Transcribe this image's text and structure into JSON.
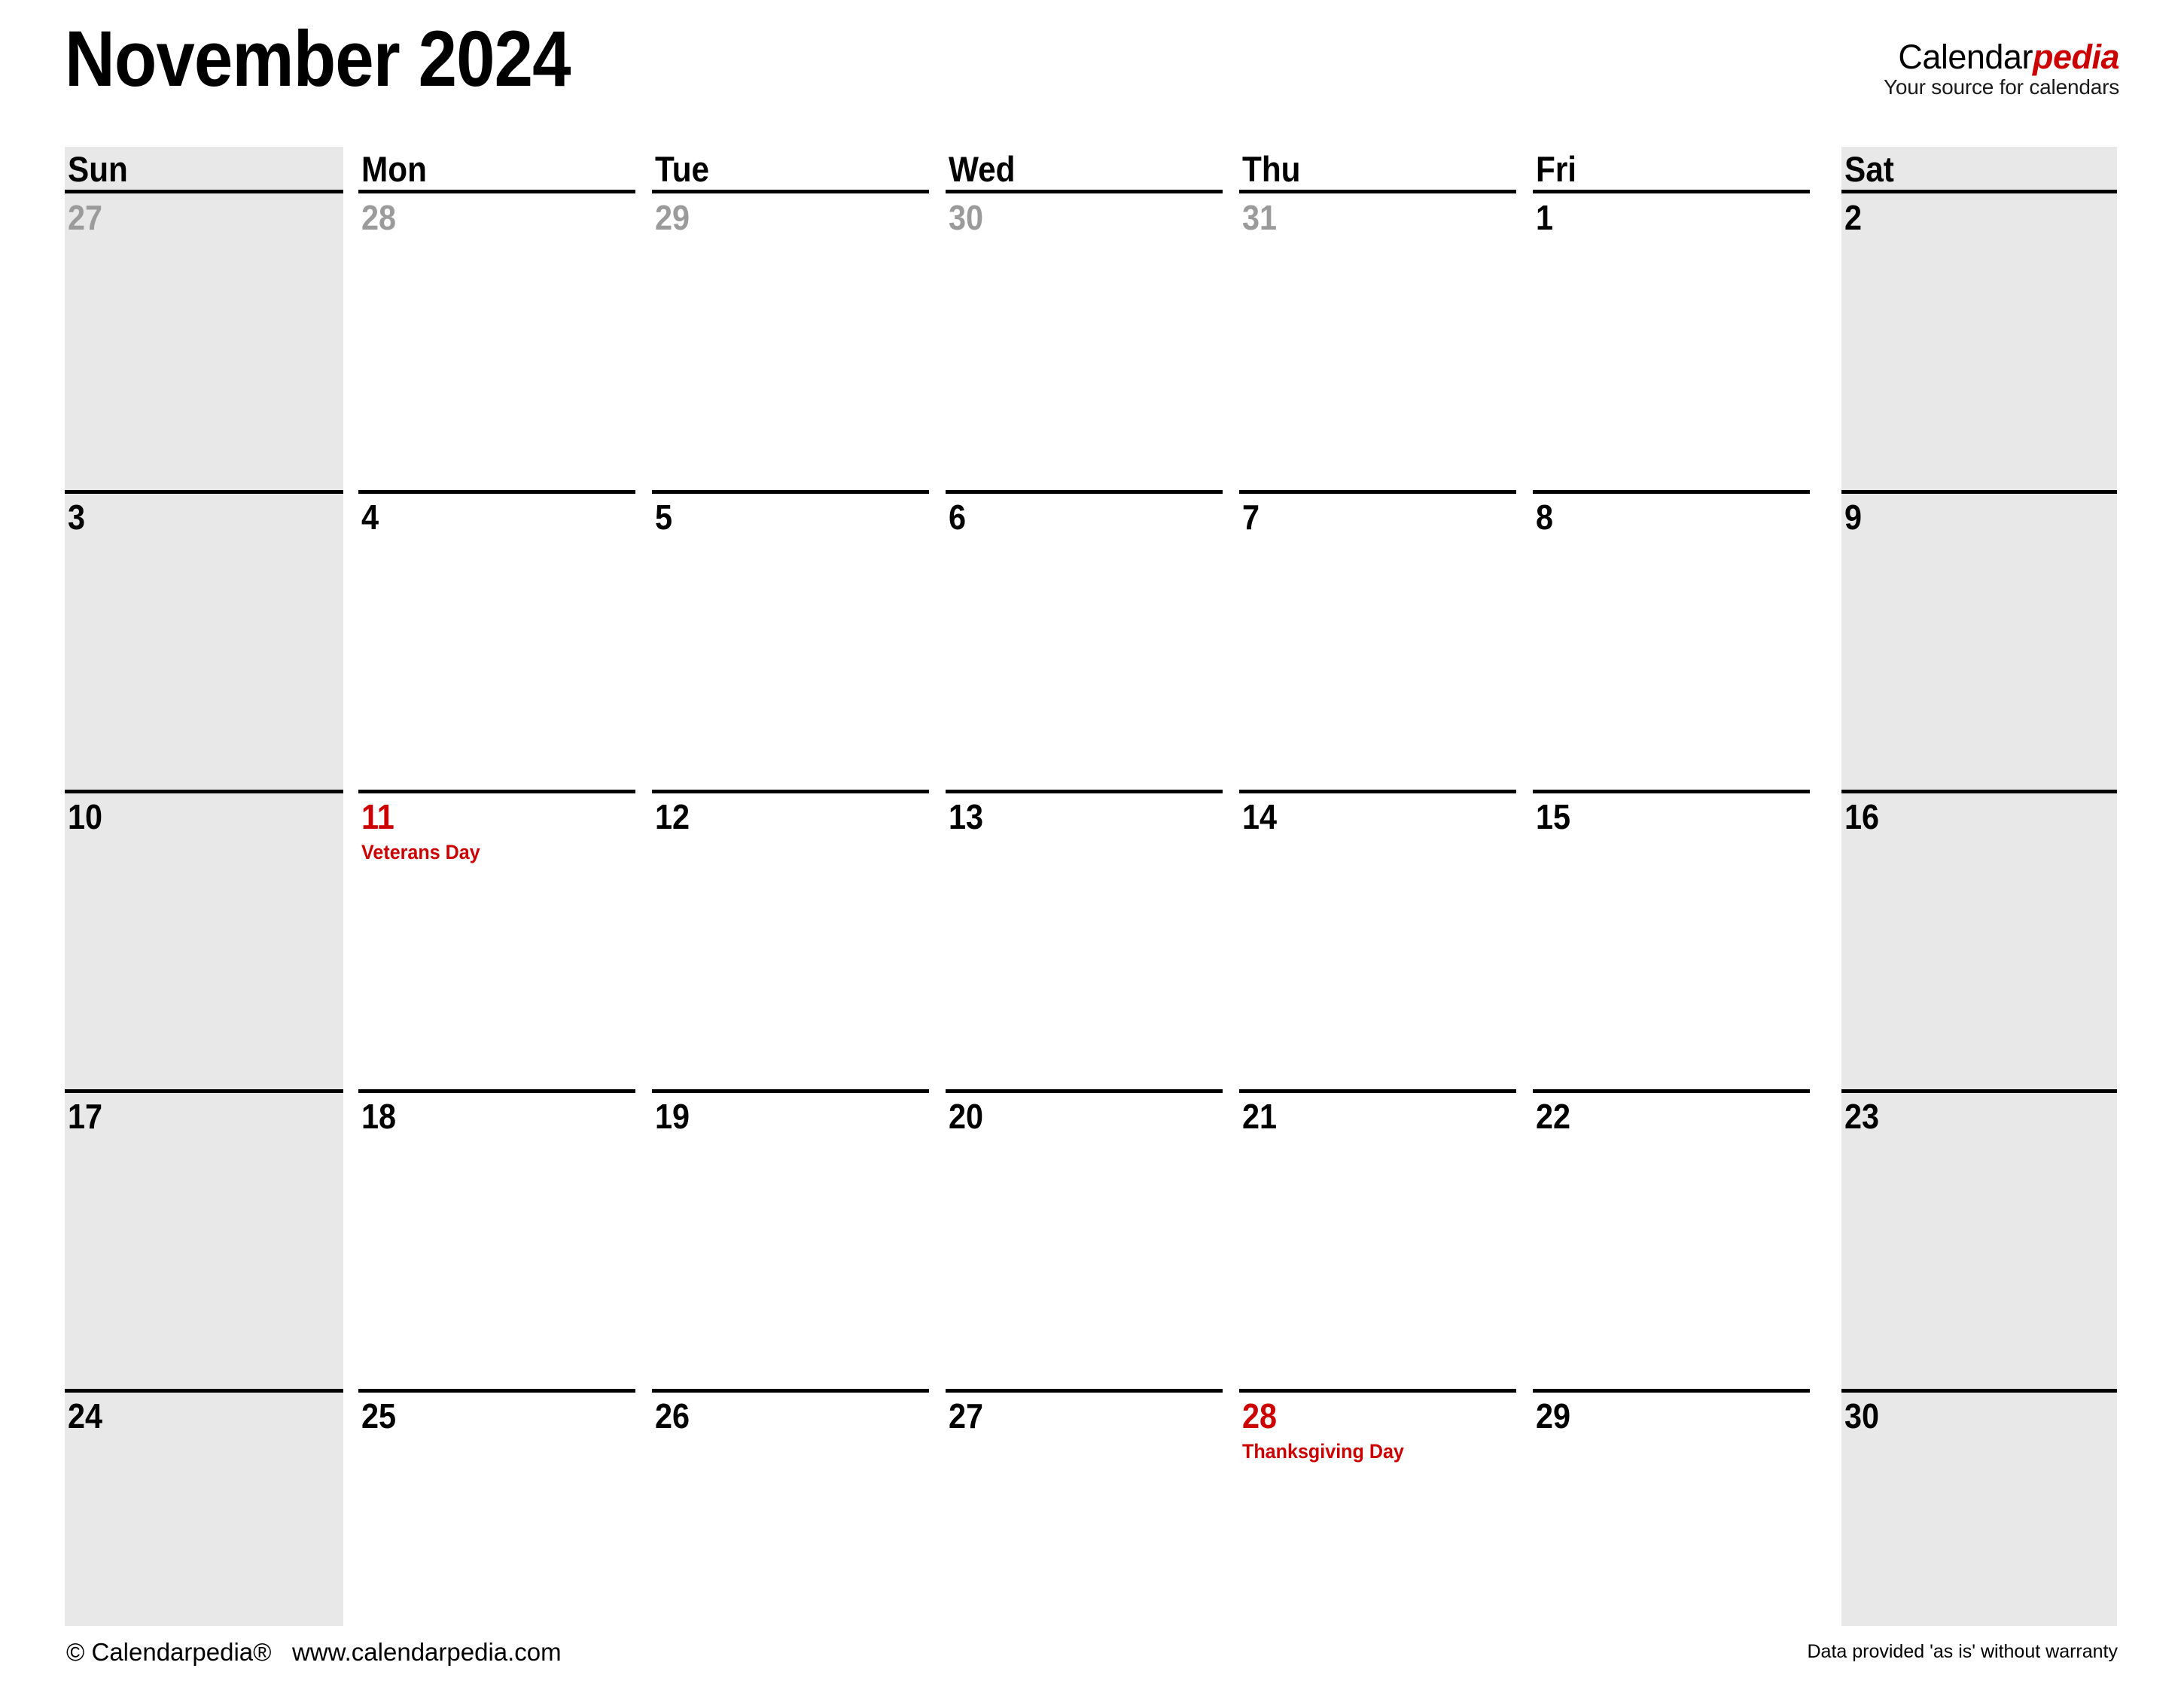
{
  "header": {
    "month_title": "November 2024",
    "brand_part1": "Calendar",
    "brand_part2": "pedia",
    "brand_tagline": "Your source for calendars"
  },
  "colors": {
    "holiday_red": "#cc0000",
    "weekend_shade": "#e8e8e8",
    "muted_date": "#9b9b9b",
    "rule": "#000000"
  },
  "calendar": {
    "weekday_headers": [
      "Sun",
      "Mon",
      "Tue",
      "Wed",
      "Thu",
      "Fri",
      "Sat"
    ],
    "weeks": [
      [
        {
          "num": "27",
          "muted": true,
          "holiday": false,
          "event": ""
        },
        {
          "num": "28",
          "muted": true,
          "holiday": false,
          "event": ""
        },
        {
          "num": "29",
          "muted": true,
          "holiday": false,
          "event": ""
        },
        {
          "num": "30",
          "muted": true,
          "holiday": false,
          "event": ""
        },
        {
          "num": "31",
          "muted": true,
          "holiday": false,
          "event": ""
        },
        {
          "num": "1",
          "muted": false,
          "holiday": false,
          "event": ""
        },
        {
          "num": "2",
          "muted": false,
          "holiday": false,
          "event": ""
        }
      ],
      [
        {
          "num": "3",
          "muted": false,
          "holiday": false,
          "event": ""
        },
        {
          "num": "4",
          "muted": false,
          "holiday": false,
          "event": ""
        },
        {
          "num": "5",
          "muted": false,
          "holiday": false,
          "event": ""
        },
        {
          "num": "6",
          "muted": false,
          "holiday": false,
          "event": ""
        },
        {
          "num": "7",
          "muted": false,
          "holiday": false,
          "event": ""
        },
        {
          "num": "8",
          "muted": false,
          "holiday": false,
          "event": ""
        },
        {
          "num": "9",
          "muted": false,
          "holiday": false,
          "event": ""
        }
      ],
      [
        {
          "num": "10",
          "muted": false,
          "holiday": false,
          "event": ""
        },
        {
          "num": "11",
          "muted": false,
          "holiday": true,
          "event": "Veterans Day"
        },
        {
          "num": "12",
          "muted": false,
          "holiday": false,
          "event": ""
        },
        {
          "num": "13",
          "muted": false,
          "holiday": false,
          "event": ""
        },
        {
          "num": "14",
          "muted": false,
          "holiday": false,
          "event": ""
        },
        {
          "num": "15",
          "muted": false,
          "holiday": false,
          "event": ""
        },
        {
          "num": "16",
          "muted": false,
          "holiday": false,
          "event": ""
        }
      ],
      [
        {
          "num": "17",
          "muted": false,
          "holiday": false,
          "event": ""
        },
        {
          "num": "18",
          "muted": false,
          "holiday": false,
          "event": ""
        },
        {
          "num": "19",
          "muted": false,
          "holiday": false,
          "event": ""
        },
        {
          "num": "20",
          "muted": false,
          "holiday": false,
          "event": ""
        },
        {
          "num": "21",
          "muted": false,
          "holiday": false,
          "event": ""
        },
        {
          "num": "22",
          "muted": false,
          "holiday": false,
          "event": ""
        },
        {
          "num": "23",
          "muted": false,
          "holiday": false,
          "event": ""
        }
      ],
      [
        {
          "num": "24",
          "muted": false,
          "holiday": false,
          "event": ""
        },
        {
          "num": "25",
          "muted": false,
          "holiday": false,
          "event": ""
        },
        {
          "num": "26",
          "muted": false,
          "holiday": false,
          "event": ""
        },
        {
          "num": "27",
          "muted": false,
          "holiday": false,
          "event": ""
        },
        {
          "num": "28",
          "muted": false,
          "holiday": true,
          "event": "Thanksgiving Day"
        },
        {
          "num": "29",
          "muted": false,
          "holiday": false,
          "event": ""
        },
        {
          "num": "30",
          "muted": false,
          "holiday": false,
          "event": ""
        }
      ]
    ]
  },
  "footer": {
    "copyright": "© Calendarpedia®   www.calendarpedia.com",
    "disclaimer": "Data provided 'as is' without warranty"
  }
}
